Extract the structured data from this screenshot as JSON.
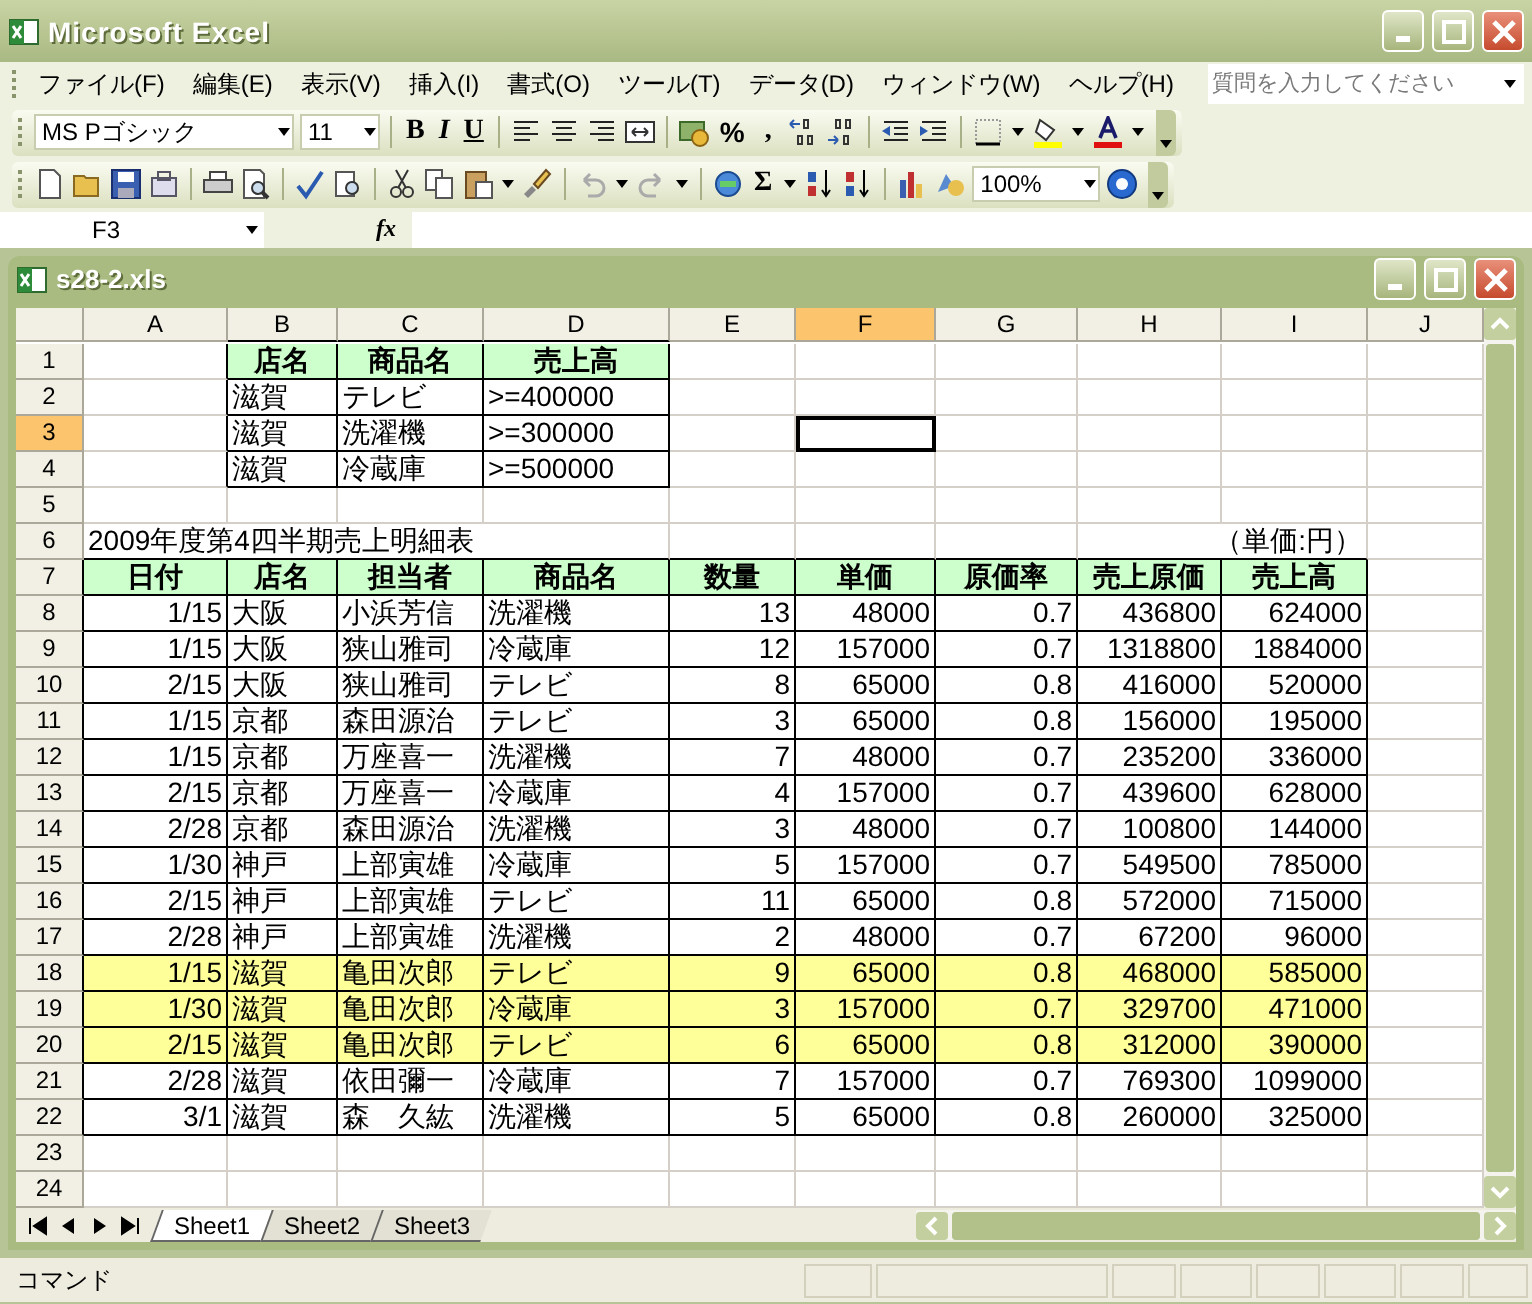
{
  "window": {
    "title": "Microsoft Excel"
  },
  "menu": [
    "ファイル(F)",
    "編集(E)",
    "表示(V)",
    "挿入(I)",
    "書式(O)",
    "ツール(T)",
    "データ(D)",
    "ウィンドウ(W)",
    "ヘルプ(H)"
  ],
  "help_box": {
    "placeholder": "質問を入力してください"
  },
  "formatting_toolbar": {
    "font": "MS Pゴシック",
    "size": "11",
    "style_buttons": [
      "B",
      "I",
      "U"
    ],
    "percent": "%",
    "comma": ","
  },
  "standard_toolbar": {
    "sum": "Σ",
    "zoom": "100%"
  },
  "formula_bar": {
    "name_box": "F3",
    "function_label": "fx"
  },
  "workbook": {
    "title": "s28-2.xls"
  },
  "sheet": {
    "columns": [
      {
        "label": "A",
        "selected": false
      },
      {
        "label": "B",
        "selected": false
      },
      {
        "label": "C",
        "selected": false
      },
      {
        "label": "D",
        "selected": false
      },
      {
        "label": "E",
        "selected": false
      },
      {
        "label": "F",
        "selected": true
      },
      {
        "label": "G",
        "selected": false
      },
      {
        "label": "H",
        "selected": false
      },
      {
        "label": "I",
        "selected": false
      },
      {
        "label": "J",
        "selected": false
      }
    ],
    "rows": [
      {
        "label": "1",
        "selected": false
      },
      {
        "label": "2",
        "selected": false
      },
      {
        "label": "3",
        "selected": true
      },
      {
        "label": "4",
        "selected": false
      },
      {
        "label": "5",
        "selected": false
      },
      {
        "label": "6",
        "selected": false
      },
      {
        "label": "7",
        "selected": false
      },
      {
        "label": "8",
        "selected": false
      },
      {
        "label": "9",
        "selected": false
      },
      {
        "label": "10",
        "selected": false
      },
      {
        "label": "11",
        "selected": false
      },
      {
        "label": "12",
        "selected": false
      },
      {
        "label": "13",
        "selected": false
      },
      {
        "label": "14",
        "selected": false
      },
      {
        "label": "15",
        "selected": false
      },
      {
        "label": "16",
        "selected": false
      },
      {
        "label": "17",
        "selected": false
      },
      {
        "label": "18",
        "selected": false
      },
      {
        "label": "19",
        "selected": false
      },
      {
        "label": "20",
        "selected": false
      },
      {
        "label": "21",
        "selected": false
      },
      {
        "label": "22",
        "selected": false
      },
      {
        "label": "23",
        "selected": false
      },
      {
        "label": "24",
        "selected": false
      }
    ]
  },
  "criteria_table": {
    "columns": [
      "店名",
      "商品名",
      "売上高"
    ],
    "rows": [
      [
        "滋賀",
        "テレビ",
        ">=400000"
      ],
      [
        "滋賀",
        "洗濯機",
        ">=300000"
      ],
      [
        "滋賀",
        "冷蔵庫",
        ">=500000"
      ]
    ]
  },
  "report": {
    "title": "2009年度第4四半期売上明細表",
    "unit": "（単価:円）",
    "columns": [
      "日付",
      "店名",
      "担当者",
      "商品名",
      "数量",
      "単価",
      "原価率",
      "売上原価",
      "売上高"
    ],
    "rows": [
      {
        "highlighted": false,
        "cells": [
          "1/15",
          "大阪",
          "小浜芳信",
          "洗濯機",
          "13",
          "48000",
          "0.7",
          "436800",
          "624000"
        ]
      },
      {
        "highlighted": false,
        "cells": [
          "1/15",
          "大阪",
          "狭山雅司",
          "冷蔵庫",
          "12",
          "157000",
          "0.7",
          "1318800",
          "1884000"
        ]
      },
      {
        "highlighted": false,
        "cells": [
          "2/15",
          "大阪",
          "狭山雅司",
          "テレビ",
          "8",
          "65000",
          "0.8",
          "416000",
          "520000"
        ]
      },
      {
        "highlighted": false,
        "cells": [
          "1/15",
          "京都",
          "森田源治",
          "テレビ",
          "3",
          "65000",
          "0.8",
          "156000",
          "195000"
        ]
      },
      {
        "highlighted": false,
        "cells": [
          "1/15",
          "京都",
          "万座喜一",
          "洗濯機",
          "7",
          "48000",
          "0.7",
          "235200",
          "336000"
        ]
      },
      {
        "highlighted": false,
        "cells": [
          "2/15",
          "京都",
          "万座喜一",
          "冷蔵庫",
          "4",
          "157000",
          "0.7",
          "439600",
          "628000"
        ]
      },
      {
        "highlighted": false,
        "cells": [
          "2/28",
          "京都",
          "森田源治",
          "洗濯機",
          "3",
          "48000",
          "0.7",
          "100800",
          "144000"
        ]
      },
      {
        "highlighted": false,
        "cells": [
          "1/30",
          "神戸",
          "上部寅雄",
          "冷蔵庫",
          "5",
          "157000",
          "0.7",
          "549500",
          "785000"
        ]
      },
      {
        "highlighted": false,
        "cells": [
          "2/15",
          "神戸",
          "上部寅雄",
          "テレビ",
          "11",
          "65000",
          "0.8",
          "572000",
          "715000"
        ]
      },
      {
        "highlighted": false,
        "cells": [
          "2/28",
          "神戸",
          "上部寅雄",
          "洗濯機",
          "2",
          "48000",
          "0.7",
          "67200",
          "96000"
        ]
      },
      {
        "highlighted": true,
        "cells": [
          "1/15",
          "滋賀",
          "亀田次郎",
          "テレビ",
          "9",
          "65000",
          "0.8",
          "468000",
          "585000"
        ]
      },
      {
        "highlighted": true,
        "cells": [
          "1/30",
          "滋賀",
          "亀田次郎",
          "冷蔵庫",
          "3",
          "157000",
          "0.7",
          "329700",
          "471000"
        ]
      },
      {
        "highlighted": true,
        "cells": [
          "2/15",
          "滋賀",
          "亀田次郎",
          "テレビ",
          "6",
          "65000",
          "0.8",
          "312000",
          "390000"
        ]
      },
      {
        "highlighted": false,
        "cells": [
          "2/28",
          "滋賀",
          "依田彌一",
          "冷蔵庫",
          "7",
          "157000",
          "0.7",
          "769300",
          "1099000"
        ]
      },
      {
        "highlighted": false,
        "cells": [
          "3/1",
          "滋賀",
          "森　久紘",
          "洗濯機",
          "5",
          "65000",
          "0.8",
          "260000",
          "325000"
        ]
      }
    ]
  },
  "sheet_tabs": [
    {
      "label": "Sheet1",
      "selected": true
    },
    {
      "label": "Sheet2",
      "selected": false
    },
    {
      "label": "Sheet3",
      "selected": false
    }
  ],
  "status_bar": {
    "text": "コマンド"
  }
}
